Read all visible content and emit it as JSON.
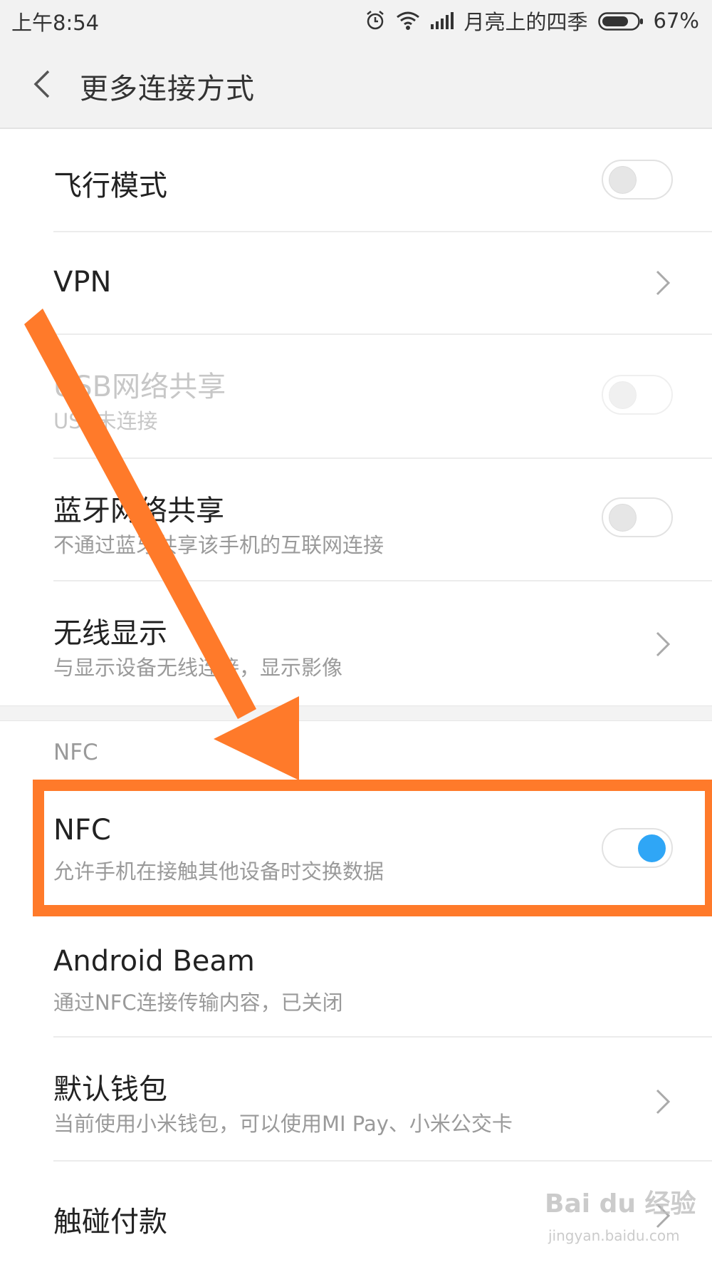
{
  "status_bar": {
    "time": "上午8:54",
    "carrier": "月亮上的四季",
    "battery": "67%",
    "icons": [
      "alarm-icon",
      "wifi-icon",
      "signal-icon",
      "battery-icon"
    ]
  },
  "header": {
    "back_icon": "back-chevron-icon",
    "title": "更多连接方式"
  },
  "rows": {
    "airplane": {
      "label": "飞行模式",
      "toggle_on": false
    },
    "vpn": {
      "label": "VPN"
    },
    "usb_tether": {
      "label": "USB网络共享",
      "sub": "USB未连接",
      "toggle_on": false,
      "disabled": true
    },
    "bt_tether": {
      "label": "蓝牙网络共享",
      "sub": "不通过蓝牙共享该手机的互联网连接",
      "toggle_on": false
    },
    "wireless_display": {
      "label": "无线显示",
      "sub": "与显示设备无线连接，显示影像"
    },
    "nfc_section_title": "NFC",
    "nfc": {
      "label": "NFC",
      "sub": "允许手机在接触其他设备时交换数据",
      "toggle_on": true
    },
    "android_beam": {
      "label": "Android Beam",
      "sub": "通过NFC连接传输内容，已关闭"
    },
    "default_wallet": {
      "label": "默认钱包",
      "sub": "当前使用小米钱包，可以使用MI Pay、小米公交卡"
    },
    "tap_pay": {
      "label": "触碰付款"
    }
  },
  "annotation": {
    "arrow_color": "#ff7a2a",
    "highlight_color": "#ff7a2a"
  },
  "watermark": {
    "brand": "Bai du 经验",
    "url": "jingyan.baidu.com"
  },
  "colors": {
    "toggle_on": "#2fa6f6",
    "background": "#ffffff",
    "header_bg": "#f2f2f2"
  }
}
